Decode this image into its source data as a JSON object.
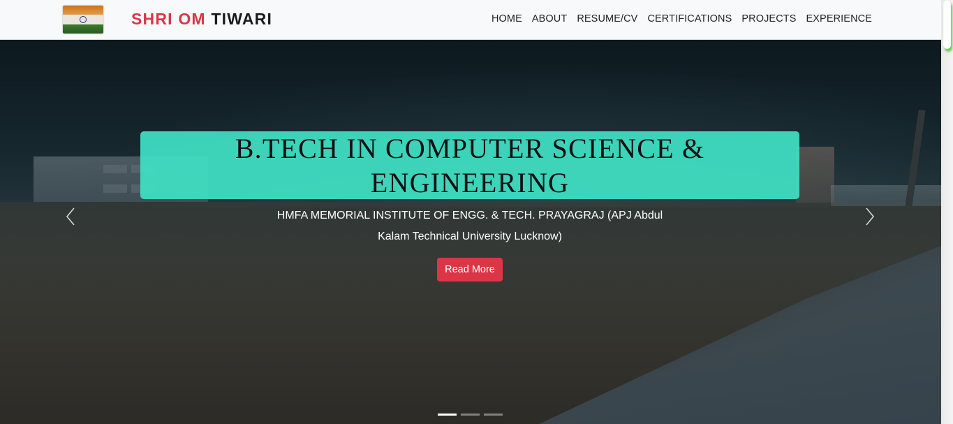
{
  "brand": {
    "first": "SHRI OM",
    "last": "TIWARI"
  },
  "nav": {
    "items": [
      {
        "label": "HOME"
      },
      {
        "label": "ABOUT"
      },
      {
        "label": "RESUME/CV"
      },
      {
        "label": "CERTIFICATIONS"
      },
      {
        "label": "PROJECTS"
      },
      {
        "label": "EXPERIENCE"
      }
    ]
  },
  "hero": {
    "title": "B.TECH IN COMPUTER SCIENCE & ENGINEERING",
    "subtitle": "HMFA MEMORIAL INSTITUTE OF ENGG. & TECH. PRAYAGRAJ (APJ Abdul Kalam Technical University Lucknow)",
    "button_label": "Read More",
    "slides_count": 3,
    "active_slide": 1
  },
  "icons": {
    "flag": "india-flag-icon",
    "prev": "chevron-left-icon",
    "next": "chevron-right-icon"
  },
  "colors": {
    "accent": "#dc3545",
    "caption_bg": "#40e0c4",
    "navbar_bg": "#f8f9fa"
  }
}
